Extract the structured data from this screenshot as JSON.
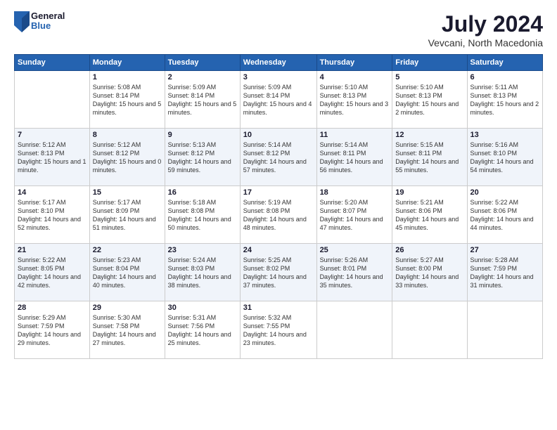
{
  "logo": {
    "general": "General",
    "blue": "Blue"
  },
  "title": {
    "month_year": "July 2024",
    "location": "Vevcani, North Macedonia"
  },
  "days_of_week": [
    "Sunday",
    "Monday",
    "Tuesday",
    "Wednesday",
    "Thursday",
    "Friday",
    "Saturday"
  ],
  "weeks": [
    [
      {
        "day": "",
        "sunrise": "",
        "sunset": "",
        "daylight": ""
      },
      {
        "day": "1",
        "sunrise": "Sunrise: 5:08 AM",
        "sunset": "Sunset: 8:14 PM",
        "daylight": "Daylight: 15 hours and 5 minutes."
      },
      {
        "day": "2",
        "sunrise": "Sunrise: 5:09 AM",
        "sunset": "Sunset: 8:14 PM",
        "daylight": "Daylight: 15 hours and 5 minutes."
      },
      {
        "day": "3",
        "sunrise": "Sunrise: 5:09 AM",
        "sunset": "Sunset: 8:14 PM",
        "daylight": "Daylight: 15 hours and 4 minutes."
      },
      {
        "day": "4",
        "sunrise": "Sunrise: 5:10 AM",
        "sunset": "Sunset: 8:13 PM",
        "daylight": "Daylight: 15 hours and 3 minutes."
      },
      {
        "day": "5",
        "sunrise": "Sunrise: 5:10 AM",
        "sunset": "Sunset: 8:13 PM",
        "daylight": "Daylight: 15 hours and 2 minutes."
      },
      {
        "day": "6",
        "sunrise": "Sunrise: 5:11 AM",
        "sunset": "Sunset: 8:13 PM",
        "daylight": "Daylight: 15 hours and 2 minutes."
      }
    ],
    [
      {
        "day": "7",
        "sunrise": "Sunrise: 5:12 AM",
        "sunset": "Sunset: 8:13 PM",
        "daylight": "Daylight: 15 hours and 1 minute."
      },
      {
        "day": "8",
        "sunrise": "Sunrise: 5:12 AM",
        "sunset": "Sunset: 8:12 PM",
        "daylight": "Daylight: 15 hours and 0 minutes."
      },
      {
        "day": "9",
        "sunrise": "Sunrise: 5:13 AM",
        "sunset": "Sunset: 8:12 PM",
        "daylight": "Daylight: 14 hours and 59 minutes."
      },
      {
        "day": "10",
        "sunrise": "Sunrise: 5:14 AM",
        "sunset": "Sunset: 8:12 PM",
        "daylight": "Daylight: 14 hours and 57 minutes."
      },
      {
        "day": "11",
        "sunrise": "Sunrise: 5:14 AM",
        "sunset": "Sunset: 8:11 PM",
        "daylight": "Daylight: 14 hours and 56 minutes."
      },
      {
        "day": "12",
        "sunrise": "Sunrise: 5:15 AM",
        "sunset": "Sunset: 8:11 PM",
        "daylight": "Daylight: 14 hours and 55 minutes."
      },
      {
        "day": "13",
        "sunrise": "Sunrise: 5:16 AM",
        "sunset": "Sunset: 8:10 PM",
        "daylight": "Daylight: 14 hours and 54 minutes."
      }
    ],
    [
      {
        "day": "14",
        "sunrise": "Sunrise: 5:17 AM",
        "sunset": "Sunset: 8:10 PM",
        "daylight": "Daylight: 14 hours and 52 minutes."
      },
      {
        "day": "15",
        "sunrise": "Sunrise: 5:17 AM",
        "sunset": "Sunset: 8:09 PM",
        "daylight": "Daylight: 14 hours and 51 minutes."
      },
      {
        "day": "16",
        "sunrise": "Sunrise: 5:18 AM",
        "sunset": "Sunset: 8:08 PM",
        "daylight": "Daylight: 14 hours and 50 minutes."
      },
      {
        "day": "17",
        "sunrise": "Sunrise: 5:19 AM",
        "sunset": "Sunset: 8:08 PM",
        "daylight": "Daylight: 14 hours and 48 minutes."
      },
      {
        "day": "18",
        "sunrise": "Sunrise: 5:20 AM",
        "sunset": "Sunset: 8:07 PM",
        "daylight": "Daylight: 14 hours and 47 minutes."
      },
      {
        "day": "19",
        "sunrise": "Sunrise: 5:21 AM",
        "sunset": "Sunset: 8:06 PM",
        "daylight": "Daylight: 14 hours and 45 minutes."
      },
      {
        "day": "20",
        "sunrise": "Sunrise: 5:22 AM",
        "sunset": "Sunset: 8:06 PM",
        "daylight": "Daylight: 14 hours and 44 minutes."
      }
    ],
    [
      {
        "day": "21",
        "sunrise": "Sunrise: 5:22 AM",
        "sunset": "Sunset: 8:05 PM",
        "daylight": "Daylight: 14 hours and 42 minutes."
      },
      {
        "day": "22",
        "sunrise": "Sunrise: 5:23 AM",
        "sunset": "Sunset: 8:04 PM",
        "daylight": "Daylight: 14 hours and 40 minutes."
      },
      {
        "day": "23",
        "sunrise": "Sunrise: 5:24 AM",
        "sunset": "Sunset: 8:03 PM",
        "daylight": "Daylight: 14 hours and 38 minutes."
      },
      {
        "day": "24",
        "sunrise": "Sunrise: 5:25 AM",
        "sunset": "Sunset: 8:02 PM",
        "daylight": "Daylight: 14 hours and 37 minutes."
      },
      {
        "day": "25",
        "sunrise": "Sunrise: 5:26 AM",
        "sunset": "Sunset: 8:01 PM",
        "daylight": "Daylight: 14 hours and 35 minutes."
      },
      {
        "day": "26",
        "sunrise": "Sunrise: 5:27 AM",
        "sunset": "Sunset: 8:00 PM",
        "daylight": "Daylight: 14 hours and 33 minutes."
      },
      {
        "day": "27",
        "sunrise": "Sunrise: 5:28 AM",
        "sunset": "Sunset: 7:59 PM",
        "daylight": "Daylight: 14 hours and 31 minutes."
      }
    ],
    [
      {
        "day": "28",
        "sunrise": "Sunrise: 5:29 AM",
        "sunset": "Sunset: 7:59 PM",
        "daylight": "Daylight: 14 hours and 29 minutes."
      },
      {
        "day": "29",
        "sunrise": "Sunrise: 5:30 AM",
        "sunset": "Sunset: 7:58 PM",
        "daylight": "Daylight: 14 hours and 27 minutes."
      },
      {
        "day": "30",
        "sunrise": "Sunrise: 5:31 AM",
        "sunset": "Sunset: 7:56 PM",
        "daylight": "Daylight: 14 hours and 25 minutes."
      },
      {
        "day": "31",
        "sunrise": "Sunrise: 5:32 AM",
        "sunset": "Sunset: 7:55 PM",
        "daylight": "Daylight: 14 hours and 23 minutes."
      },
      {
        "day": "",
        "sunrise": "",
        "sunset": "",
        "daylight": ""
      },
      {
        "day": "",
        "sunrise": "",
        "sunset": "",
        "daylight": ""
      },
      {
        "day": "",
        "sunrise": "",
        "sunset": "",
        "daylight": ""
      }
    ]
  ]
}
